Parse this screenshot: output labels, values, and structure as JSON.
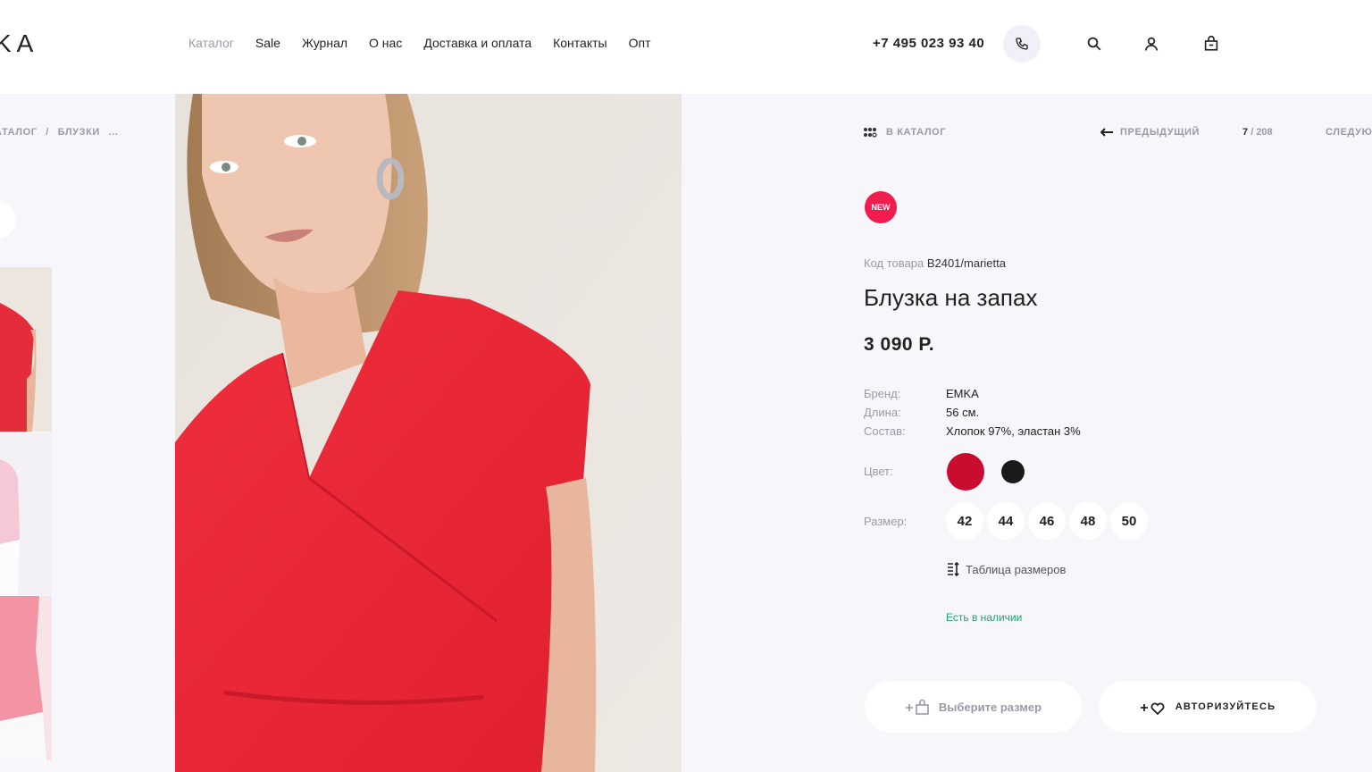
{
  "header": {
    "logo": "KA",
    "nav": [
      {
        "label": "Каталог"
      },
      {
        "label": "Sale"
      },
      {
        "label": "Журнал"
      },
      {
        "label": "О нас"
      },
      {
        "label": "Доставка и оплата"
      },
      {
        "label": "Контакты"
      },
      {
        "label": "Опт"
      }
    ],
    "phone": "+7 495 023 93 40"
  },
  "breadcrumb": [
    "АТАЛОГ",
    "/",
    "БЛУЗКИ",
    "..."
  ],
  "product_nav": {
    "back_label": "В КАТАЛОГ",
    "prev_label": "ПРЕДЫДУЩИЙ",
    "current": "7",
    "separator": "/",
    "total": "208",
    "next_label": "СЛЕДУЮ"
  },
  "product": {
    "badge": "NEW",
    "sku_label": "Код товара",
    "sku": "B2401/marietta",
    "title": "Блузка на запах",
    "price": "3 090 Р.",
    "props": [
      {
        "label": "Бренд:",
        "value": "EMKA"
      },
      {
        "label": "Длина:",
        "value": "56 см."
      },
      {
        "label": "Состав:",
        "value": "Хлопок 97%, эластан 3%"
      }
    ],
    "color_label": "Цвет:",
    "colors": [
      "#c80d30",
      "#1a1a1a"
    ],
    "size_label": "Размер:",
    "sizes": [
      "42",
      "44",
      "46",
      "48",
      "50"
    ],
    "size_table_label": "Таблица размеров",
    "stock": "Есть в наличии",
    "cart_button": "Выберите размер",
    "wishlist_button": "АВТОРИЗУЙТЕСЬ"
  },
  "accent_color": "#f01d4e"
}
